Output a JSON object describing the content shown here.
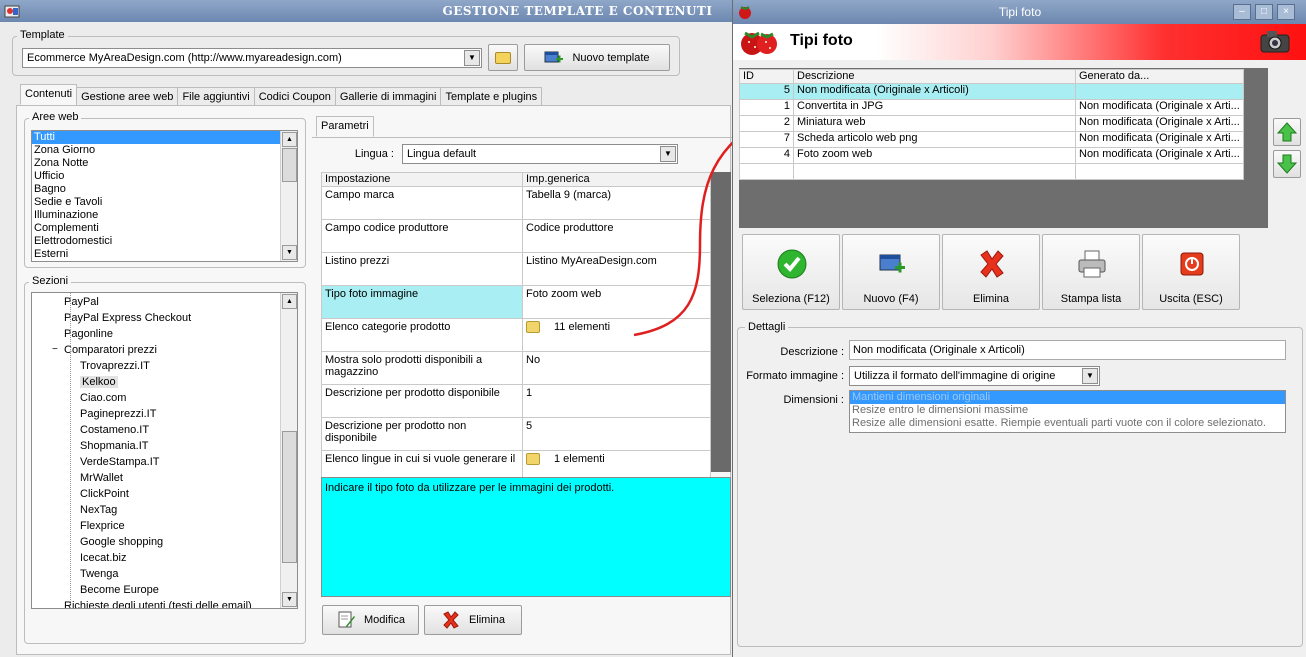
{
  "main": {
    "title": "GESTIONE TEMPLATE E CONTENUTI",
    "template_group": "Template",
    "template_value": "Ecommerce MyAreaDesign.com (http://www.myareadesign.com)",
    "new_template": "Nuovo template",
    "tabs": [
      "Contenuti",
      "Gestione aree web",
      "File aggiuntivi",
      "Codici Coupon",
      "Gallerie di immagini",
      "Template e plugins"
    ],
    "aree_web_group": "Aree web",
    "aree_web": [
      "Tutti",
      "Zona Giorno",
      "Zona Notte",
      "Ufficio",
      "Bagno",
      "Sedie e Tavoli",
      "Illuminazione",
      "Complementi",
      "Elettrodomestici",
      "Esterni"
    ],
    "sezioni_group": "Sezioni",
    "sezioni": [
      {
        "label": "PayPal",
        "lvl": 1
      },
      {
        "label": "PayPal Express Checkout",
        "lvl": 1
      },
      {
        "label": "Pagonline",
        "lvl": 1
      },
      {
        "label": "Comparatori prezzi",
        "lvl": 1,
        "expander": "−"
      },
      {
        "label": "Trovaprezzi.IT",
        "lvl": 2
      },
      {
        "label": "Kelkoo",
        "lvl": 2,
        "sel": true
      },
      {
        "label": "Ciao.com",
        "lvl": 2
      },
      {
        "label": "Pagineprezzi.IT",
        "lvl": 2
      },
      {
        "label": "Costameno.IT",
        "lvl": 2
      },
      {
        "label": "Shopmania.IT",
        "lvl": 2
      },
      {
        "label": "VerdeStampa.IT",
        "lvl": 2
      },
      {
        "label": "MrWallet",
        "lvl": 2
      },
      {
        "label": "ClickPoint",
        "lvl": 2
      },
      {
        "label": "NexTag",
        "lvl": 2
      },
      {
        "label": "Flexprice",
        "lvl": 2
      },
      {
        "label": "Google shopping",
        "lvl": 2
      },
      {
        "label": "Icecat.biz",
        "lvl": 2
      },
      {
        "label": "Twenga",
        "lvl": 2
      },
      {
        "label": "Become Europe",
        "lvl": 2
      },
      {
        "label": "Richieste degli utenti (testi delle email)",
        "lvl": 1
      }
    ],
    "parametri_tab": "Parametri",
    "lingua_label": "Lingua :",
    "lingua_value": "Lingua default",
    "params_headers": [
      "Impostazione",
      "Imp.generica"
    ],
    "params": [
      {
        "k": "Campo marca",
        "v": "Tabella 9 (marca)"
      },
      {
        "k": "Campo codice produttore",
        "v": "Codice produttore"
      },
      {
        "k": "Listino prezzi",
        "v": "Listino MyAreaDesign.com"
      },
      {
        "k": "Tipo foto immagine",
        "v": "Foto zoom web",
        "hl": true
      },
      {
        "k": "Elenco categorie prodotto",
        "v": "11 elementi",
        "folder": true
      },
      {
        "k": "Mostra solo prodotti disponibili a magazzino",
        "v": "No"
      },
      {
        "k": "Descrizione per prodotto disponibile",
        "v": "1"
      },
      {
        "k": "Descrizione per prodotto non disponibile",
        "v": "5"
      },
      {
        "k": "Elenco lingue in cui si vuole generare il",
        "v": "1 elementi",
        "folder": true
      }
    ],
    "hint": "Indicare il tipo foto da utilizzare per le immagini dei prodotti.",
    "modifica": "Modifica",
    "elimina": "Elimina"
  },
  "foto": {
    "title": "Tipi foto",
    "header": "Tipi foto",
    "headers": [
      "ID",
      "Descrizione",
      "Generato da..."
    ],
    "rows": [
      {
        "id": "5",
        "desc": "Non modificata (Originale x Articoli)",
        "gen": ""
      },
      {
        "id": "1",
        "desc": "Convertita in JPG",
        "gen": "Non modificata (Originale x Arti..."
      },
      {
        "id": "2",
        "desc": "Miniatura web",
        "gen": "Non modificata (Originale x Arti..."
      },
      {
        "id": "7",
        "desc": "Scheda articolo web png",
        "gen": "Non modificata (Originale x Arti..."
      },
      {
        "id": "4",
        "desc": "Foto zoom web",
        "gen": "Non modificata (Originale x Arti..."
      }
    ],
    "buttons": {
      "seleziona": "Seleziona (F12)",
      "nuovo": "Nuovo (F4)",
      "elimina": "Elimina",
      "stampa": "Stampa lista",
      "uscita": "Uscita (ESC)"
    },
    "dettagli": "Dettagli",
    "descrizione_label": "Descrizione :",
    "descrizione_value": "Non modificata (Originale x Articoli)",
    "formato_label": "Formato immagine :",
    "formato_value": "Utilizza il formato dell'immagine di origine",
    "dimensioni_label": "Dimensioni :",
    "dimensioni_options": [
      "Mantieni dimensioni originali",
      "Resize entro le dimensioni massime",
      "Resize alle dimensioni esatte. Riempie eventuali parti vuote con il colore selezionato."
    ]
  },
  "colors": {
    "accent_red": "#e02020",
    "highlight_cyan": "#00ffff",
    "selection_blue": "#3399ff",
    "row_highlight": "#a8eef2"
  }
}
